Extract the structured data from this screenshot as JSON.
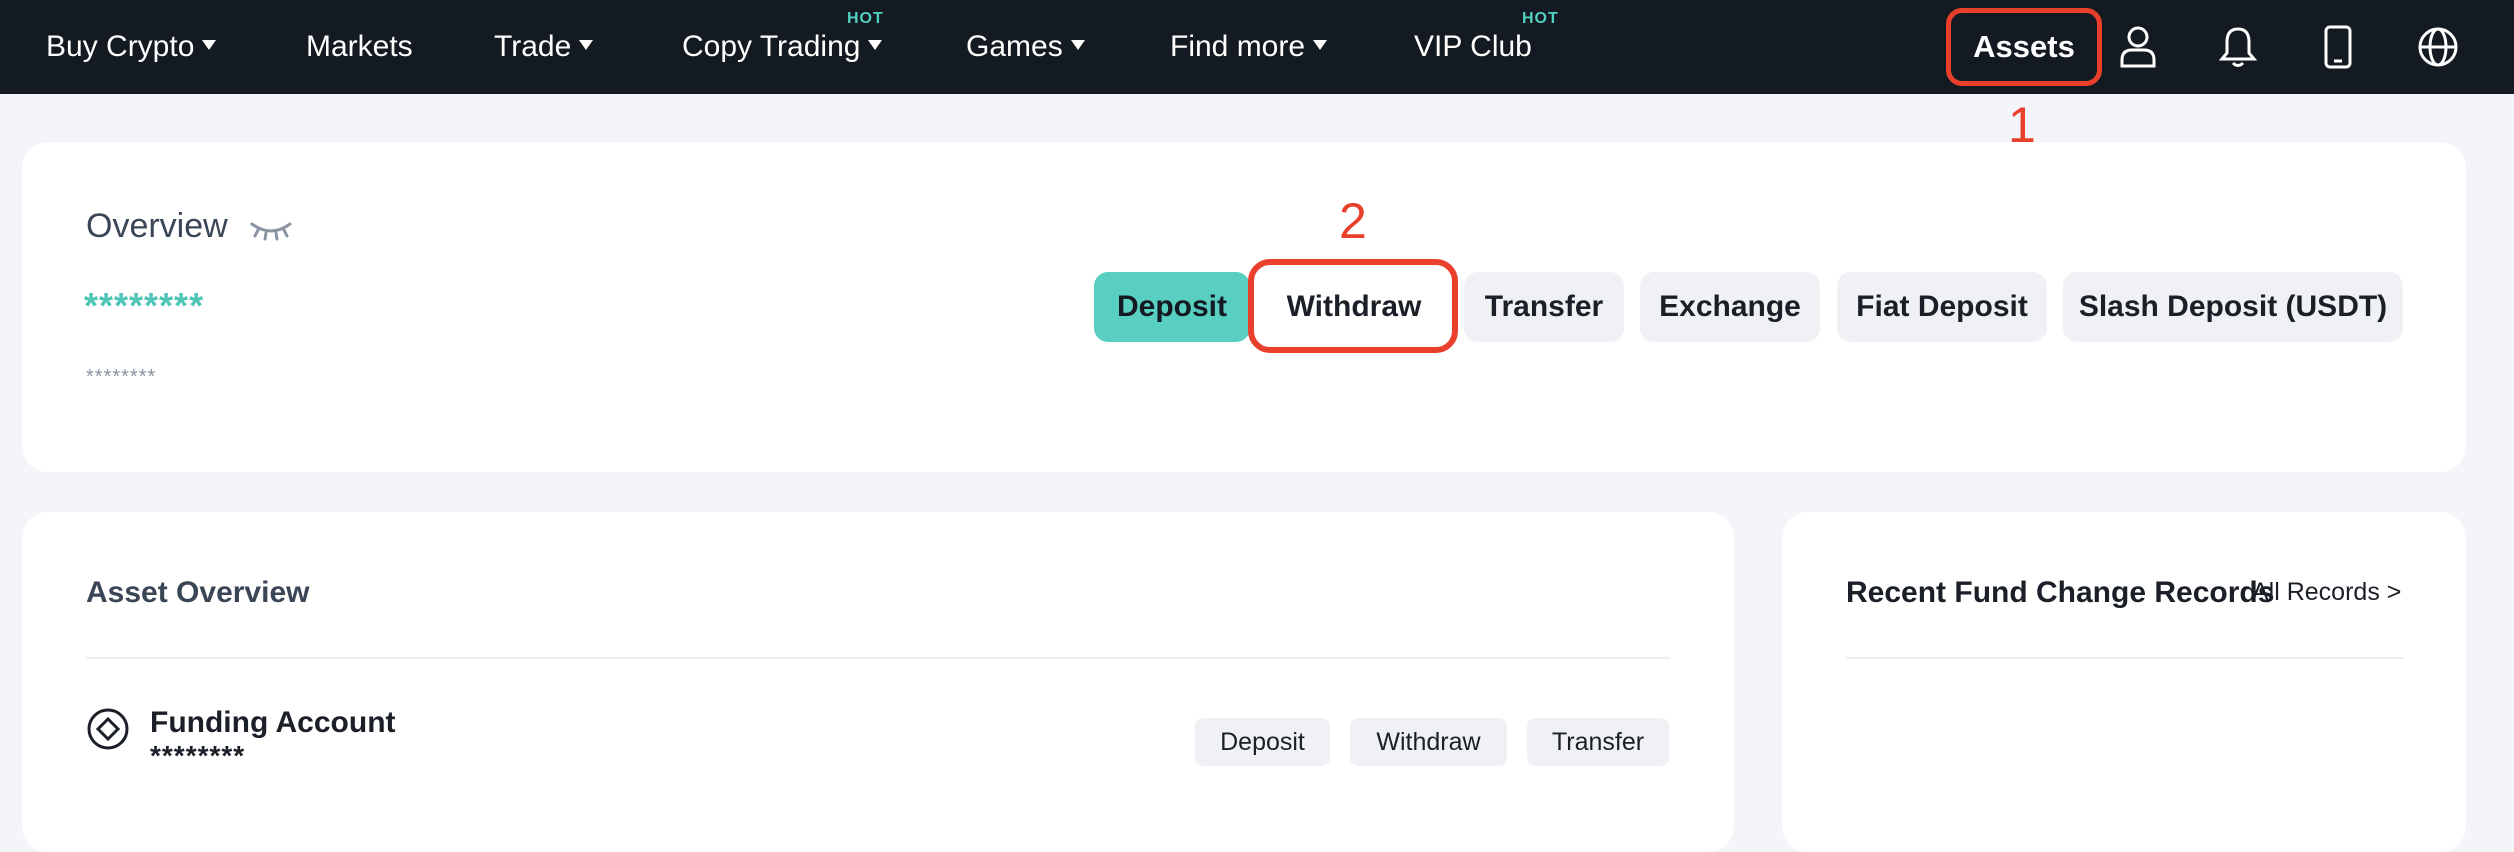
{
  "nav": {
    "items": [
      {
        "label": "Buy Crypto",
        "caret": true,
        "hot": false
      },
      {
        "label": "Markets",
        "caret": false,
        "hot": false
      },
      {
        "label": "Trade",
        "caret": true,
        "hot": false
      },
      {
        "label": "Copy Trading",
        "caret": true,
        "hot": true
      },
      {
        "label": "Games",
        "caret": true,
        "hot": false
      },
      {
        "label": "Find more",
        "caret": true,
        "hot": false
      },
      {
        "label": "VIP Club",
        "caret": false,
        "hot": true
      }
    ],
    "hot_label": "HOT",
    "assets_label": "Assets",
    "icons": [
      "user-icon",
      "bell-icon",
      "mobile-icon",
      "globe-icon"
    ]
  },
  "annotations": {
    "step1": "1",
    "step2": "2"
  },
  "overview": {
    "title": "Overview",
    "balance_masked": "********",
    "sub_masked": "********",
    "actions": [
      "Deposit",
      "Withdraw",
      "Transfer",
      "Exchange",
      "Fiat Deposit",
      "Slash Deposit (USDT)"
    ]
  },
  "asset_overview": {
    "title": "Asset Overview",
    "account": {
      "name": "Funding Account",
      "masked": "********",
      "actions": [
        "Deposit",
        "Withdraw",
        "Transfer"
      ]
    }
  },
  "records": {
    "title": "Recent Fund Change Records",
    "link": "All Records >"
  },
  "colors": {
    "nav_bg": "#141a22",
    "accent": "#59cfc1",
    "hot": "#4fd1c0",
    "annotation": "#e8402c"
  }
}
